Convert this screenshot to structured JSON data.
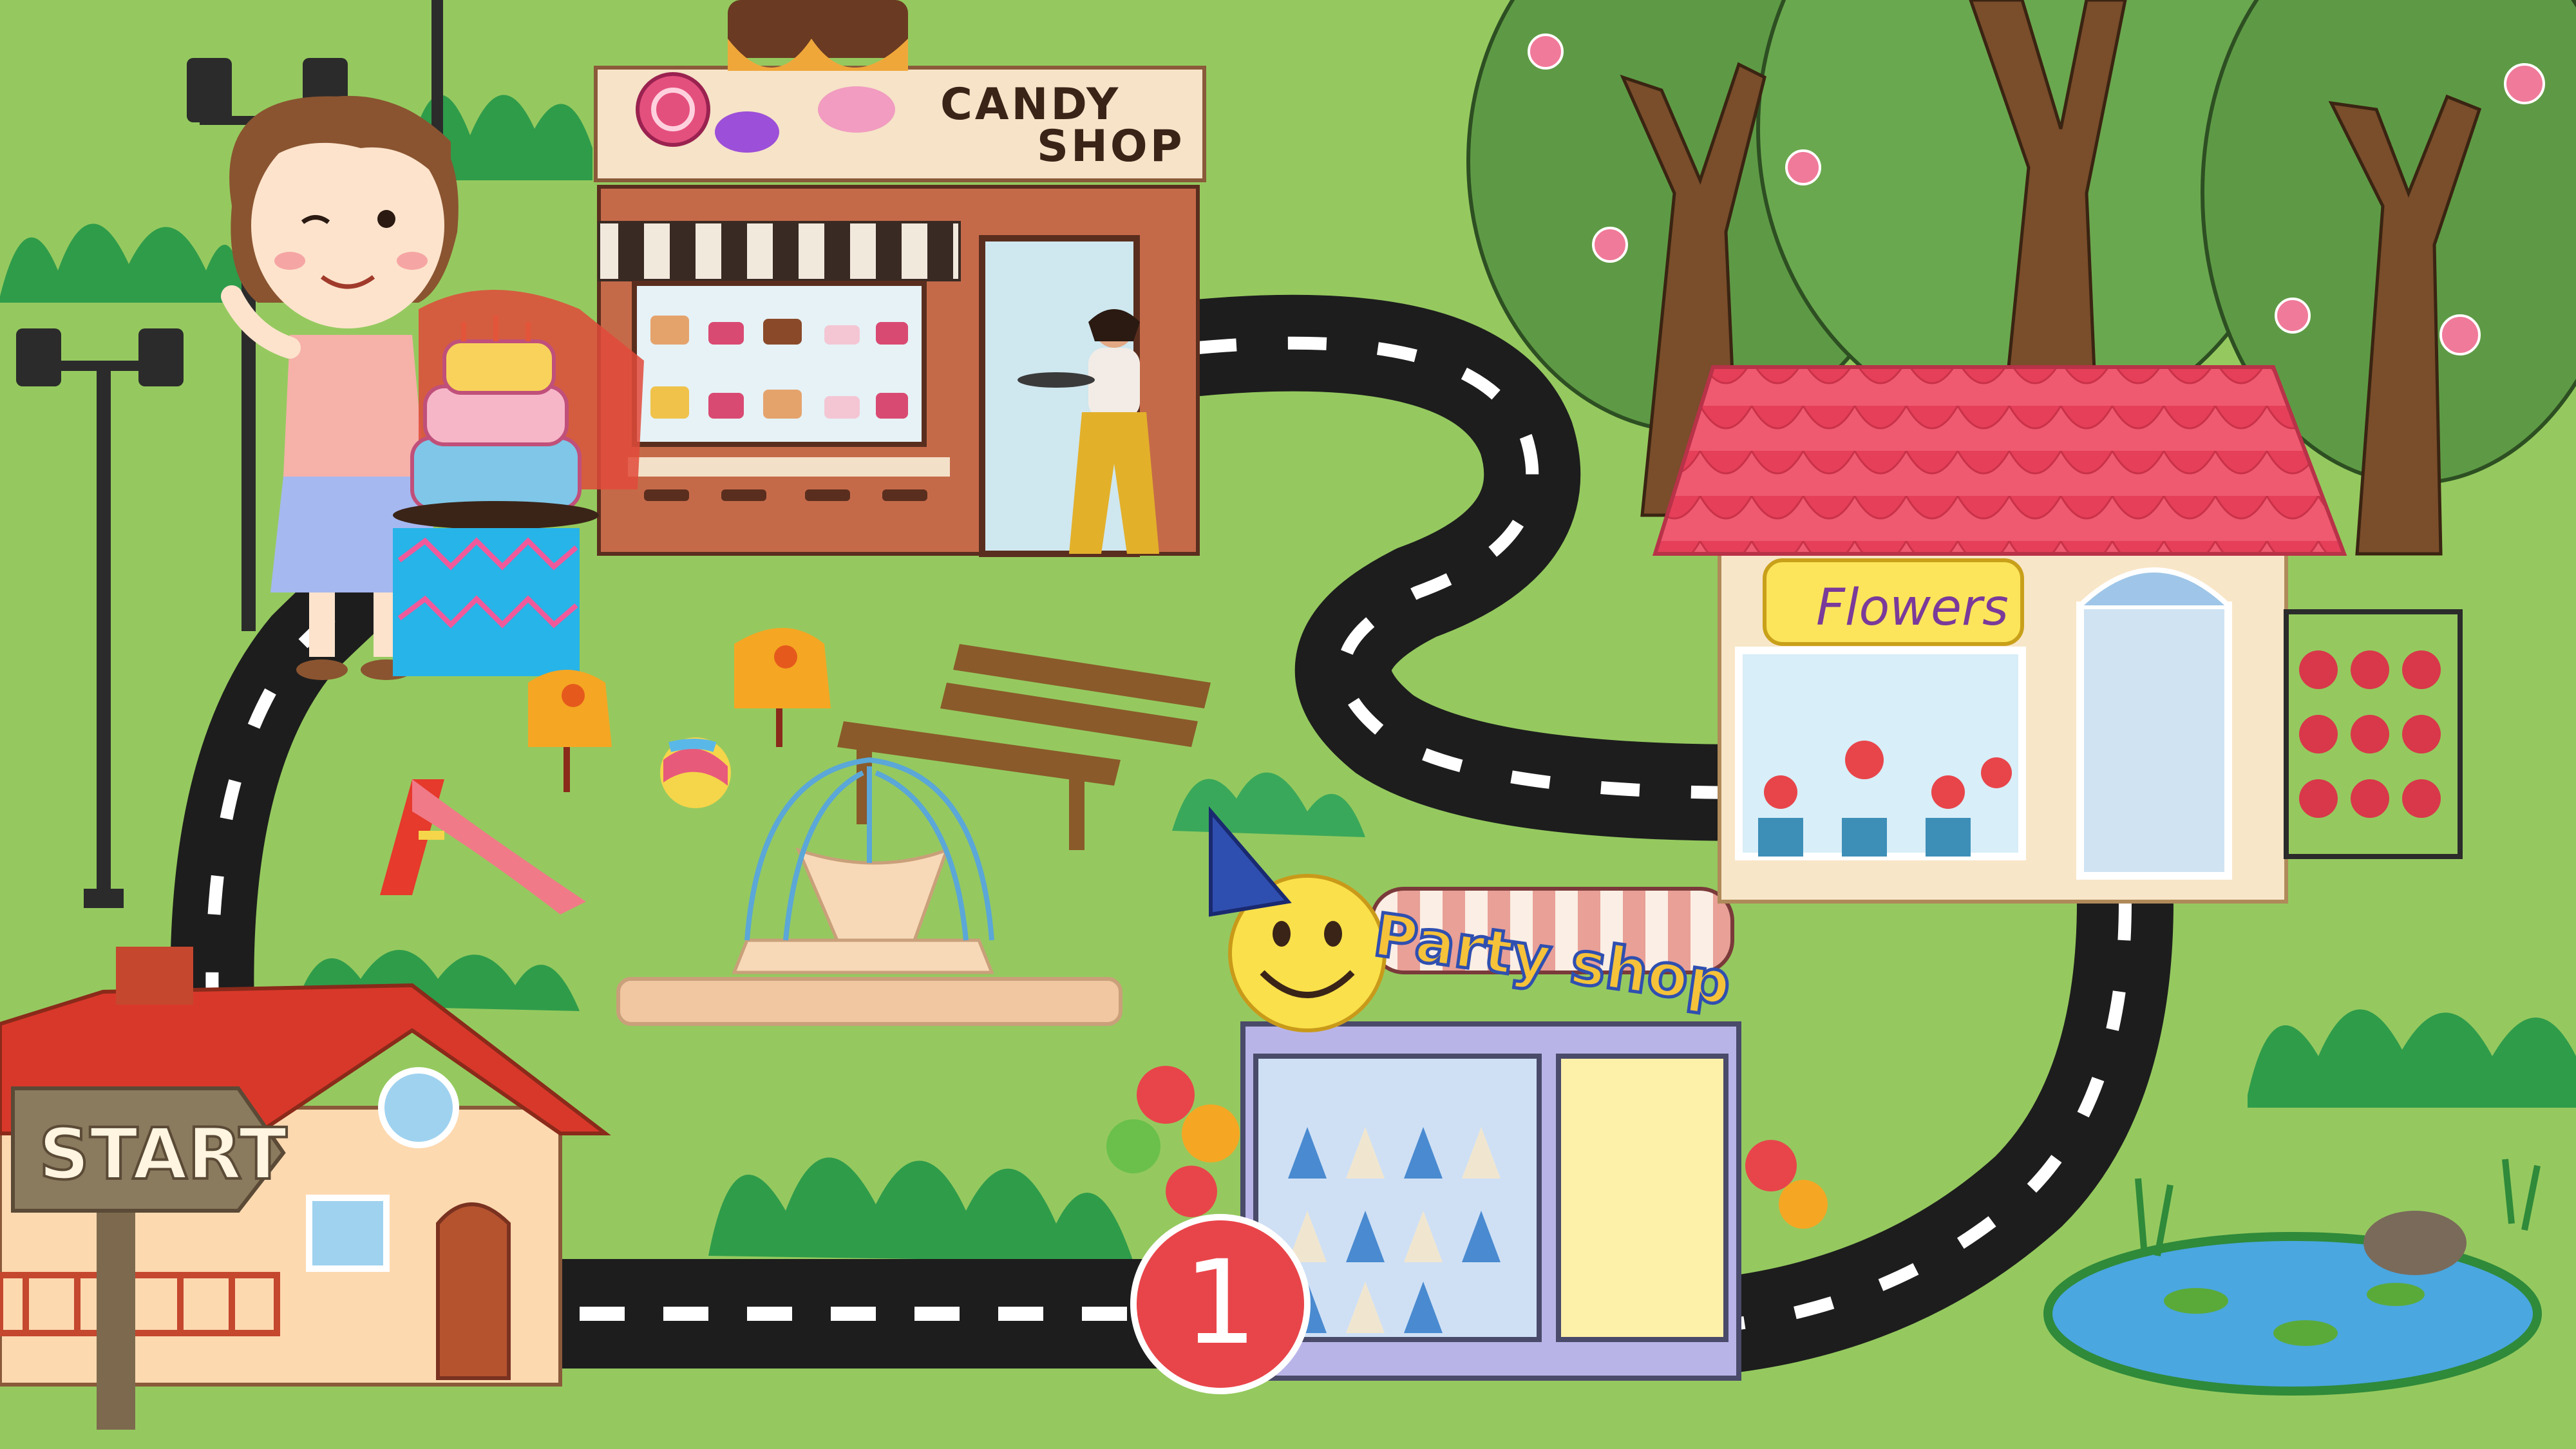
{
  "candy_shop": {
    "sign_line1": "CANDY",
    "sign_line2": "SHOP"
  },
  "flower_shop": {
    "sign": "Flowers"
  },
  "party_shop": {
    "sign": "Party shop"
  },
  "start_sign": {
    "label": "START"
  },
  "step_marker": {
    "number": "1"
  },
  "colors": {
    "grass": "#95c95f",
    "road": "#1d1d1d",
    "road_dash": "#ffffff",
    "marker": "#e8454a",
    "flower_roof": "#ee4f66",
    "pond": "#4aa7e0"
  }
}
